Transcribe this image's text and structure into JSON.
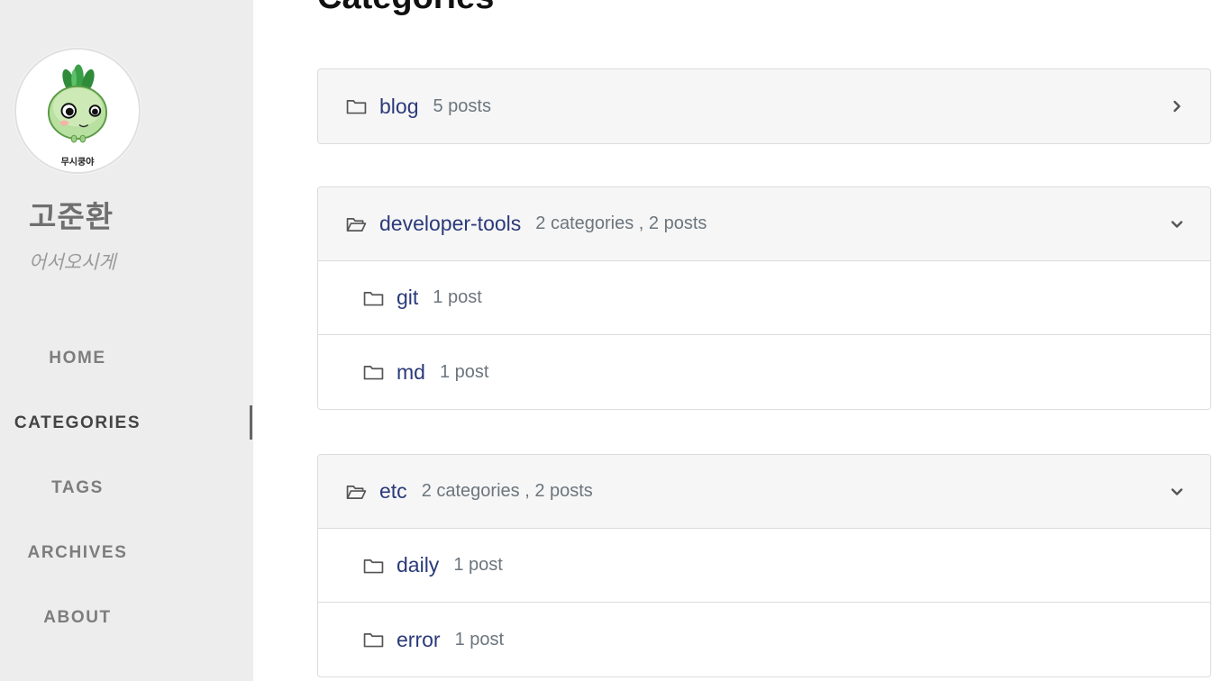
{
  "sidebar": {
    "avatar_caption": "무시쿵야",
    "site_title": "고준환",
    "site_subtitle": "어서오시게",
    "nav": [
      {
        "label": "HOME",
        "active": false
      },
      {
        "label": "CATEGORIES",
        "active": true
      },
      {
        "label": "TAGS",
        "active": false
      },
      {
        "label": "ARCHIVES",
        "active": false
      },
      {
        "label": "ABOUT",
        "active": false
      }
    ]
  },
  "main": {
    "page_title": "Categories",
    "categories": [
      {
        "name": "blog",
        "meta": "5 posts",
        "expanded": false,
        "toggle_icon": "chevron-right-icon",
        "children": []
      },
      {
        "name": "developer-tools",
        "meta": "2 categories , 2 posts",
        "expanded": true,
        "toggle_icon": "chevron-down-icon",
        "children": [
          {
            "name": "git",
            "meta": "1 post"
          },
          {
            "name": "md",
            "meta": "1 post"
          }
        ]
      },
      {
        "name": "etc",
        "meta": "2 categories , 2 posts",
        "expanded": true,
        "toggle_icon": "chevron-down-icon",
        "children": [
          {
            "name": "daily",
            "meta": "1 post"
          },
          {
            "name": "error",
            "meta": "1 post"
          }
        ]
      }
    ]
  },
  "colors": {
    "sidebar_bg": "#ededed",
    "link": "#2b3a7a",
    "meta": "#6c757d",
    "card_header_bg": "#f6f6f6"
  }
}
